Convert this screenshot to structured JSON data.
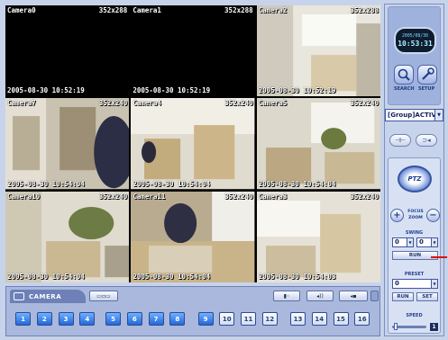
{
  "cameras": [
    {
      "label": "Camera0",
      "res": "352x288",
      "ts": "2005-08-30 10:52:19",
      "feed": "black"
    },
    {
      "label": "Camera1",
      "res": "352x288",
      "ts": "2005-08-30 10:52:19",
      "feed": "black"
    },
    {
      "label": "Camera2",
      "res": "352x288",
      "ts": "2005-08-30 10:52:19",
      "feed": "office-bright"
    },
    {
      "label": "Camera7",
      "res": "352x240",
      "ts": "2005-08-30 10:54:04",
      "feed": "doorway"
    },
    {
      "label": "Camera4",
      "res": "352x240",
      "ts": "2005-08-30 10:54:04",
      "feed": "boxes-person"
    },
    {
      "label": "Camera5",
      "res": "352x240",
      "ts": "2005-08-30 10:54:04",
      "feed": "plant-window"
    },
    {
      "label": "Camera10",
      "res": "352x240",
      "ts": "2005-08-30 10:54:04",
      "feed": "plant-room"
    },
    {
      "label": "Camera11",
      "res": "352x240",
      "ts": "2005-08-30 10:54:04",
      "feed": "desk-person"
    },
    {
      "label": "Camera3",
      "res": "352x240",
      "ts": "2005-08-30 10:54:03",
      "feed": "office-window"
    }
  ],
  "bottom_bar": {
    "tab_label": "CAMERA",
    "camera_buttons": [
      {
        "label": "1",
        "active": true
      },
      {
        "label": "2",
        "active": true
      },
      {
        "label": "3",
        "active": true
      },
      {
        "label": "4",
        "active": true
      },
      {
        "label": "5",
        "active": true
      },
      {
        "label": "6",
        "active": true
      },
      {
        "label": "7",
        "active": true
      },
      {
        "label": "8",
        "active": true
      },
      {
        "label": "9",
        "active": true
      },
      {
        "label": "10",
        "active": false
      },
      {
        "label": "11",
        "active": false
      },
      {
        "label": "12",
        "active": false
      },
      {
        "label": "13",
        "active": false
      },
      {
        "label": "14",
        "active": false
      },
      {
        "label": "15",
        "active": false
      },
      {
        "label": "16",
        "active": false
      }
    ]
  },
  "side": {
    "clock_date": "2005/08/30",
    "clock_time": "10:53:31",
    "search_label": "SEARCH",
    "setup_label": "SETUP",
    "group_value": "[Group]ACTIV",
    "ptz_label": "PTZ",
    "focus_label": "FOCUS",
    "zoom_label": "ZOOM",
    "swing_label": "SWING",
    "swing_a": "0",
    "swing_b": "0",
    "run_label": "RUN",
    "preset_label": "PRESET",
    "preset_value": "0",
    "preset_run": "RUN",
    "preset_set": "SET",
    "speed_label": "SPEED",
    "speed_value": "1"
  },
  "colors": {
    "active_button": "#2467d6",
    "panel": "#c7d3ea",
    "clock_text": "#aef0ff"
  }
}
